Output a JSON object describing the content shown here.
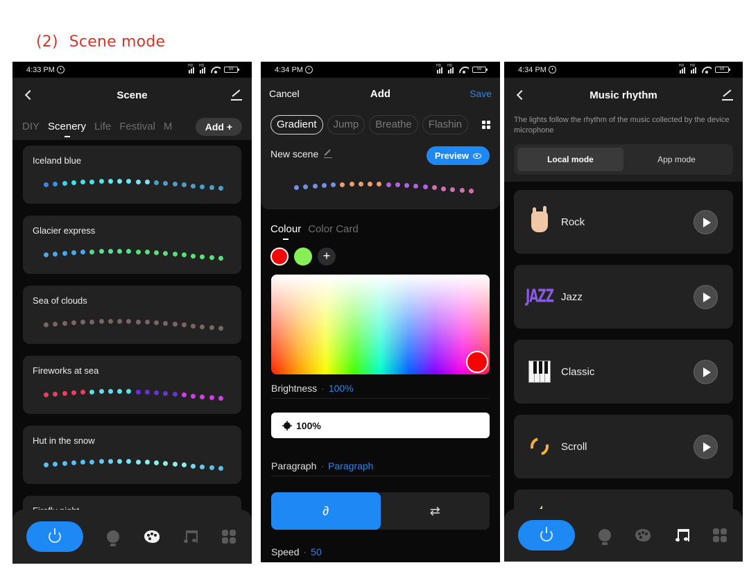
{
  "section_title": {
    "number": "(2)",
    "label": "Scene mode"
  },
  "phones": {
    "scene": {
      "status": {
        "time": "4:33 PM",
        "battery": "59"
      },
      "title": "Scene",
      "tabs": [
        "DIY",
        "Scenery",
        "Life",
        "Festival",
        "M"
      ],
      "active_tab": "Scenery",
      "add_button": "Add +",
      "scenes": [
        {
          "name": "Iceland blue",
          "colors": [
            "#3b82f0",
            "#3a8fe8",
            "#3ed4e6",
            "#3ee0ea",
            "#3fe4ea",
            "#44e6ea",
            "#4ae8ec",
            "#5eeaee",
            "#6ceaf0",
            "#72e6f0",
            "#78e4f0",
            "#80e4f0",
            "#4a9ec8",
            "#4a9ec8",
            "#4a9ec8",
            "#4a9ec8",
            "#4a9ec8",
            "#4a9ec8",
            "#4aa0c8",
            "#4aa0c8"
          ]
        },
        {
          "name": "Glacier express",
          "colors": [
            "#4aa8ea",
            "#4aa8ea",
            "#4aa8ea",
            "#4aa8ea",
            "#4aa8ea",
            "#5ad88a",
            "#5ae088",
            "#5ae088",
            "#5ae088",
            "#5ae088",
            "#5ae078",
            "#5ae078",
            "#5ae078",
            "#5ae078",
            "#5ae078",
            "#5ae078",
            "#5ae078",
            "#5ae078",
            "#5ae078",
            "#5ae078"
          ]
        },
        {
          "name": "Sea of clouds",
          "colors": [
            "#7a6464",
            "#7a6464",
            "#7a6464",
            "#7a6464",
            "#7a6464",
            "#7a6464",
            "#7a6464",
            "#7a6464",
            "#7a6464",
            "#7a6464",
            "#7a6464",
            "#7a6464",
            "#7a6464",
            "#7a6464",
            "#7a6464",
            "#7a6464",
            "#7a6464",
            "#7a6464",
            "#7a6464",
            "#7a6464"
          ]
        },
        {
          "name": "Fireworks at sea",
          "colors": [
            "#e64060",
            "#e64060",
            "#e64060",
            "#e64060",
            "#e64060",
            "#60dce6",
            "#60dce6",
            "#60dce6",
            "#60dce6",
            "#60dce6",
            "#6a30e0",
            "#6a30e0",
            "#6a30e0",
            "#6a30e0",
            "#6a30e0",
            "#d040e0",
            "#d040e0",
            "#d040e0",
            "#d040e0",
            "#d040e0"
          ]
        },
        {
          "name": "Hut in the snow",
          "colors": [
            "#58c0f0",
            "#58c0f0",
            "#58c0f0",
            "#58c0f0",
            "#58c0f0",
            "#58c0f0",
            "#62c8f0",
            "#6ad0f0",
            "#76dcf0",
            "#7ce4ee",
            "#84ecec",
            "#8cf0ea",
            "#8cf0ea",
            "#8cf0ea",
            "#8cf0ea",
            "#8cf0ea",
            "#70d8f0",
            "#64c8f0",
            "#58c0f0",
            "#58c0f0"
          ]
        },
        {
          "name": "Firefly night",
          "colors": []
        }
      ]
    },
    "add": {
      "status": {
        "time": "4:34 PM",
        "battery": "59"
      },
      "cancel": "Cancel",
      "title": "Add",
      "save": "Save",
      "modes": [
        "Gradient",
        "Jump",
        "Breathe",
        "Flashin"
      ],
      "active_mode": "Gradient",
      "scene_name": "New scene",
      "preview_button": "Preview",
      "preview_colors": [
        "#6f92e8",
        "#6f92e8",
        "#6f92e8",
        "#6f92e8",
        "#6f92e8",
        "#e8a070",
        "#e8a070",
        "#e8a070",
        "#e8a070",
        "#e8a070",
        "#b060e0",
        "#b060e0",
        "#b060e0",
        "#b060e0",
        "#b060e0",
        "#d070b0",
        "#d070b0",
        "#d070b0",
        "#d070b0",
        "#d070b0"
      ],
      "color_tabs": [
        "Colour",
        "Color Card"
      ],
      "active_color_tab": "Colour",
      "swatches": [
        "#ff0000",
        "#88ee55"
      ],
      "selected_color": "#ff0000",
      "brightness_label": "Brightness",
      "brightness_value": "100%",
      "brightness_display": "100%",
      "paragraph_label": "Paragraph",
      "paragraph_value": "Paragraph",
      "segment_options": [
        "single-segment",
        "multi-segment"
      ],
      "speed_label": "Speed",
      "speed_value": "50"
    },
    "music": {
      "status": {
        "time": "4:34 PM",
        "battery": "59"
      },
      "title": "Music rhythm",
      "description": "The lights follow the rhythm of the music collected by the device microphone",
      "modes": [
        "Local mode",
        "App mode"
      ],
      "active_mode": "Local mode",
      "items": [
        {
          "name": "Rock",
          "icon": "rock-hand-icon"
        },
        {
          "name": "Jazz",
          "icon": "jazz-icon",
          "icon_text": "JAZZ"
        },
        {
          "name": "Classic",
          "icon": "piano-icon"
        },
        {
          "name": "Scroll",
          "icon": "scroll-icon"
        },
        {
          "name": "",
          "icon": "partial-icon"
        }
      ]
    }
  },
  "colors": {
    "accent": "#1e88f5",
    "link": "#2f86e0",
    "title_red": "#d0362a"
  }
}
